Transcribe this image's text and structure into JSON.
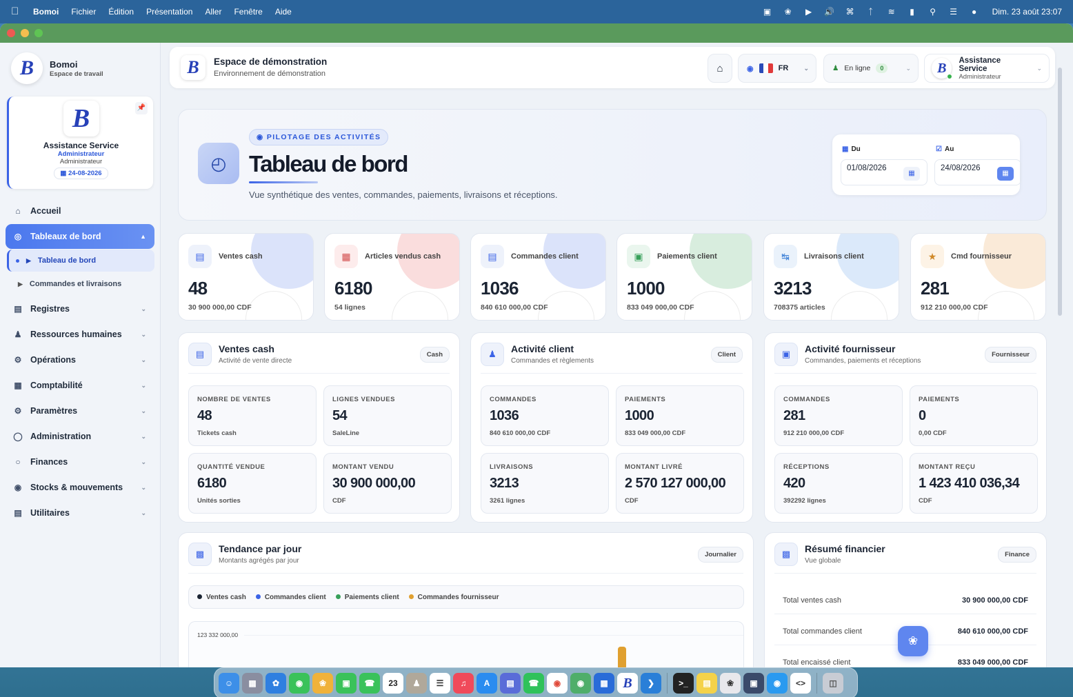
{
  "menubar": {
    "app": "Bomoi",
    "items": [
      "Fichier",
      "Édition",
      "Présentation",
      "Aller",
      "Fenêtre",
      "Aide"
    ],
    "clock": "Dim. 23 août  23:07"
  },
  "sidebar": {
    "brand_name": "Bomoi",
    "brand_sub": "Espace de travail",
    "profile": {
      "name": "Assistance Service",
      "role_primary": "Administrateur",
      "role_secondary": "Administrateur",
      "date": "24-08-2026"
    },
    "nav": {
      "accueil": "Accueil",
      "tableaux": "Tableaux de bord",
      "sub_tableau": "Tableau de bord",
      "sub_commandes": "Commandes et livraisons",
      "registres": "Registres",
      "rh": "Ressources humaines",
      "operations": "Opérations",
      "comptabilite": "Comptabilité",
      "parametres": "Paramètres",
      "administration": "Administration",
      "finances": "Finances",
      "stocks": "Stocks & mouvements",
      "utilitaires": "Utilitaires"
    }
  },
  "topbar": {
    "title": "Espace de démonstration",
    "subtitle": "Environnement de démonstration",
    "lang": "FR",
    "status": "En ligne",
    "status_count": "0",
    "user_name": "Assistance Service",
    "user_role": "Administrateur"
  },
  "hero": {
    "tag": "PILOTAGE DES ACTIVITÉS",
    "title": "Tableau de bord",
    "subtitle": "Vue synthétique des ventes, commandes, paiements, livraisons et réceptions.",
    "from_label": "Du",
    "from_value": "01/08/2026",
    "to_label": "Au",
    "to_value": "24/08/2026"
  },
  "kpis": [
    {
      "label": "Ventes cash",
      "value": "48",
      "sub": "30 900 000,00 CDF"
    },
    {
      "label": "Articles vendus cash",
      "value": "6180",
      "sub": "54 lignes"
    },
    {
      "label": "Commandes client",
      "value": "1036",
      "sub": "840 610 000,00 CDF"
    },
    {
      "label": "Paiements client",
      "value": "1000",
      "sub": "833 049 000,00 CDF"
    },
    {
      "label": "Livraisons client",
      "value": "3213",
      "sub": "708375 articles"
    },
    {
      "label": "Cmd fournisseur",
      "value": "281",
      "sub": "912 210 000,00 CDF"
    }
  ],
  "colors": {
    "accent": "#3b63e6",
    "kpi_tints": [
      "#5b7fe6",
      "#e66464",
      "#5b7fe6",
      "#4caf6a",
      "#5b9be6",
      "#e6a04c"
    ]
  },
  "panels": {
    "cash": {
      "title": "Ventes cash",
      "sub": "Activité de vente directe",
      "badge": "Cash",
      "stats": [
        {
          "label": "NOMBRE DE VENTES",
          "value": "48",
          "sub": "Tickets cash"
        },
        {
          "label": "LIGNES VENDUES",
          "value": "54",
          "sub": "SaleLine"
        },
        {
          "label": "QUANTITÉ VENDUE",
          "value": "6180",
          "sub": "Unités sorties"
        },
        {
          "label": "MONTANT VENDU",
          "value": "30 900 000,00",
          "sub": "CDF"
        }
      ]
    },
    "client": {
      "title": "Activité client",
      "sub": "Commandes et règlements",
      "badge": "Client",
      "stats": [
        {
          "label": "COMMANDES",
          "value": "1036",
          "sub": "840 610 000,00 CDF"
        },
        {
          "label": "PAIEMENTS",
          "value": "1000",
          "sub": "833 049 000,00 CDF"
        },
        {
          "label": "LIVRAISONS",
          "value": "3213",
          "sub": "3261 lignes"
        },
        {
          "label": "MONTANT LIVRÉ",
          "value": "2 570 127 000,00",
          "sub": "CDF"
        }
      ]
    },
    "fournisseur": {
      "title": "Activité fournisseur",
      "sub": "Commandes, paiements et réceptions",
      "badge": "Fournisseur",
      "stats": [
        {
          "label": "COMMANDES",
          "value": "281",
          "sub": "912 210 000,00 CDF"
        },
        {
          "label": "PAIEMENTS",
          "value": "0",
          "sub": "0,00 CDF"
        },
        {
          "label": "RÉCEPTIONS",
          "value": "420",
          "sub": "392292 lignes"
        },
        {
          "label": "MONTANT REÇU",
          "value": "1 423 410 036,34",
          "sub": "CDF"
        }
      ]
    },
    "trend": {
      "title": "Tendance par jour",
      "sub": "Montants agrégés par jour",
      "badge": "Journalier",
      "legend": [
        "Ventes cash",
        "Commandes client",
        "Paiements client",
        "Commandes fournisseur"
      ],
      "legend_colors": [
        "#1b2433",
        "#3b63e6",
        "#37a05a",
        "#e0a030"
      ],
      "ytick": "123 332 000,00"
    },
    "finance": {
      "title": "Résumé financier",
      "sub": "Vue globale",
      "badge": "Finance",
      "rows": [
        {
          "label": "Total ventes cash",
          "value": "30 900 000,00 CDF"
        },
        {
          "label": "Total commandes client",
          "value": "840 610 000,00 CDF"
        },
        {
          "label": "Total encaissé client",
          "value": "833 049 000,00 CDF"
        }
      ]
    }
  },
  "dock": {
    "calendar_day": "23"
  }
}
